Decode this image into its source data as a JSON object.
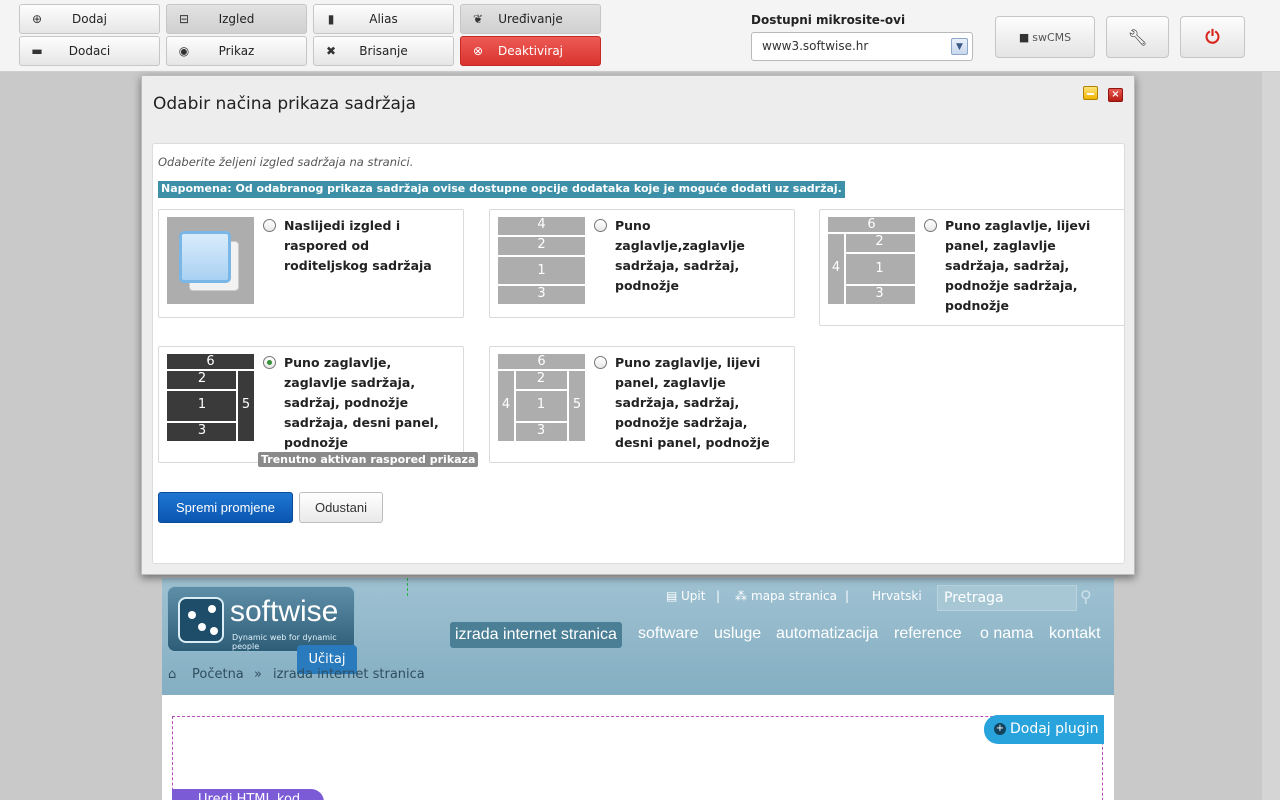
{
  "toolbar": {
    "dodaj": "Dodaj",
    "dodaci": "Dodaci",
    "izgled": "Izgled",
    "prikaz": "Prikaz",
    "alias": "Alias",
    "brisanje": "Brisanje",
    "uredivanje": "Uređivanje",
    "deaktiviraj": "Deaktiviraj",
    "microsites_label": "Dostupni mikrosite-ovi",
    "microsite_selected": "www3.softwise.hr",
    "swcms": "swCMS"
  },
  "modal": {
    "title": "Odabir načina prikaza sadržaja",
    "intro": "Odaberite željeni izgled sadržaja na stranici.",
    "note": "Napomena: Od odabranog prikaza sadržaja ovise dostupne opcije dodataka koje je moguće dodati uz sadržaj.",
    "options": [
      {
        "lines": [
          "Naslijedi izgled i",
          "raspored od",
          "roditeljskog sadržaja"
        ],
        "selected": false
      },
      {
        "lines": [
          "Puno",
          "zaglavlje,zaglavlje",
          "sadržaja, sadržaj,",
          "podnožje"
        ],
        "cells": [
          "4",
          "2",
          "1",
          "3"
        ],
        "selected": false
      },
      {
        "lines": [
          "Puno zaglavlje, lijevi",
          "panel, zaglavlje",
          "sadržaja, sadržaj,",
          "podnožje sadržaja,",
          "podnožje"
        ],
        "cells": [
          "6",
          "2",
          "4",
          "1",
          "3"
        ],
        "selected": false
      },
      {
        "lines": [
          "Puno zaglavlje,",
          "zaglavlje sadržaja,",
          "sadržaj, podnožje",
          "sadržaja, desni panel,",
          "podnožje"
        ],
        "cells": [
          "6",
          "2",
          "1",
          "5",
          "3"
        ],
        "selected": true
      },
      {
        "lines": [
          "Puno zaglavlje, lijevi",
          "panel, zaglavlje",
          "sadržaja, sadržaj,",
          "podnožje sadržaja,",
          "desni panel, podnožje"
        ],
        "cells": [
          "6",
          "2",
          "4",
          "1",
          "5",
          "3"
        ],
        "selected": false
      }
    ],
    "active_badge": "Trenutno aktivan raspored prikaza",
    "save": "Spremi promjene",
    "cancel": "Odustani"
  },
  "site": {
    "logo": "softwise",
    "tagline": "Dynamic web for dynamic people",
    "ucitaj": "Učitaj",
    "top_links": [
      "Upit",
      "mapa stranica",
      "Hrvatski"
    ],
    "search_placeholder": "Pretraga",
    "nav": [
      "izrada internet stranica",
      "software",
      "usluge",
      "automatizacija",
      "reference",
      "o nama",
      "kontakt"
    ],
    "breadcrumb": [
      "Početna",
      "izrada internet stranica"
    ],
    "add_plugin": "Dodaj plugin",
    "edit_html": "Uredi HTML kod"
  }
}
